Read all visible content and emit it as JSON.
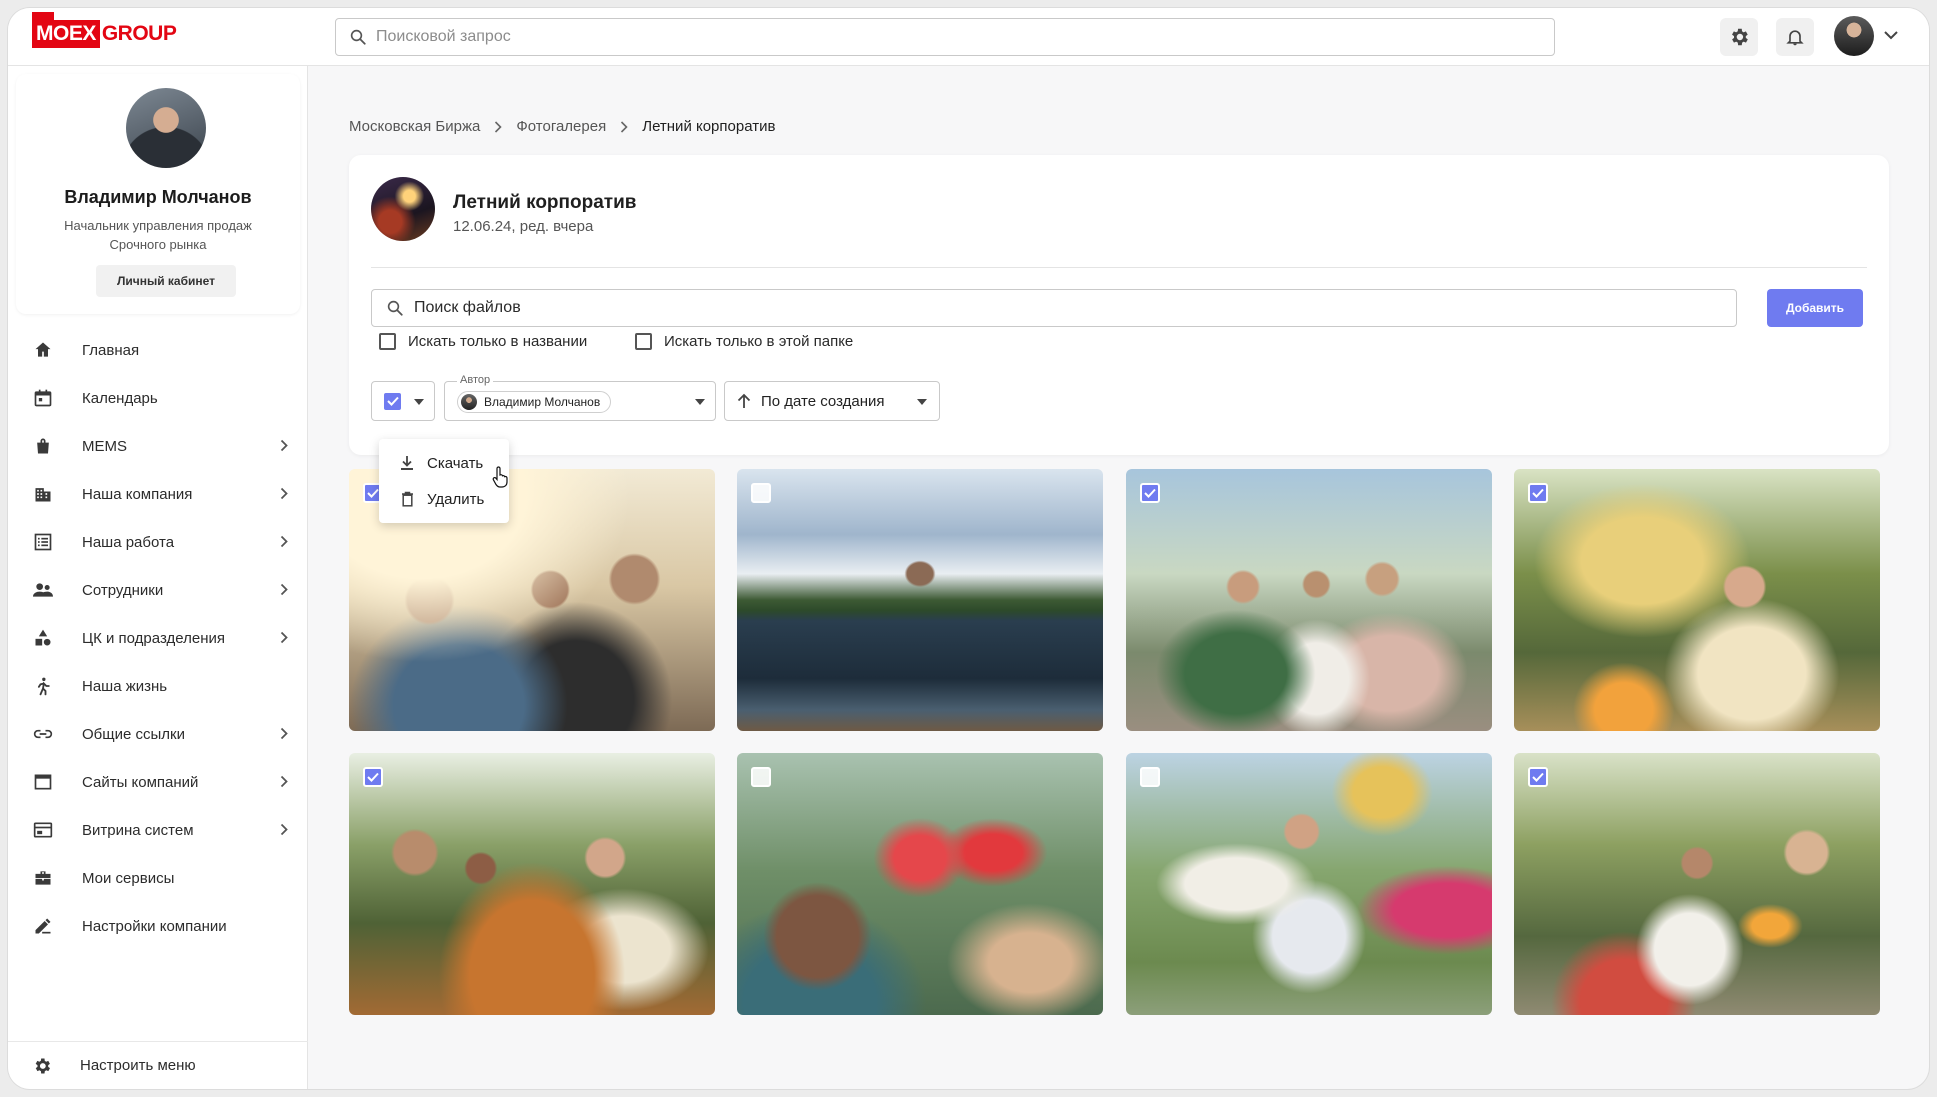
{
  "header": {
    "logo_moex": "MOEX",
    "logo_group": "GROUP",
    "search_placeholder": "Поисковой запрос",
    "icons": [
      "gear-icon",
      "bell-icon",
      "avatar",
      "chevron-down-icon"
    ]
  },
  "profile": {
    "name": "Владимир Молчанов",
    "role": "Начальник управления продаж Срочного рынка",
    "cabinet_label": "Личный кабинет"
  },
  "sidebar": {
    "items": [
      {
        "label": "Главная",
        "icon": "home-icon",
        "has_submenu": false
      },
      {
        "label": "Календарь",
        "icon": "calendar-icon",
        "has_submenu": false
      },
      {
        "label": "MEMS",
        "icon": "bag-icon",
        "has_submenu": true
      },
      {
        "label": "Наша компания",
        "icon": "building-icon",
        "has_submenu": true
      },
      {
        "label": "Наша работа",
        "icon": "list-icon",
        "has_submenu": true
      },
      {
        "label": "Сотрудники",
        "icon": "people-icon",
        "has_submenu": true
      },
      {
        "label": "ЦК и подразделения",
        "icon": "shapes-icon",
        "has_submenu": true
      },
      {
        "label": "Наша жизнь",
        "icon": "runner-icon",
        "has_submenu": false
      },
      {
        "label": "Общие ссылки",
        "icon": "link-icon",
        "has_submenu": true
      },
      {
        "label": "Сайты компаний",
        "icon": "window-icon",
        "has_submenu": true
      },
      {
        "label": "Витрина систем",
        "icon": "display-icon",
        "has_submenu": true
      },
      {
        "label": "Мои сервисы",
        "icon": "toolbox-icon",
        "has_submenu": false
      },
      {
        "label": "Настройки компании",
        "icon": "edit-icon",
        "has_submenu": false
      }
    ],
    "bottom_label": "Настроить меню"
  },
  "breadcrumb": {
    "items": [
      "Московская Биржа",
      "Фотогалерея",
      "Летний корпоратив"
    ]
  },
  "album": {
    "title": "Летний корпоратив",
    "meta": "12.06.24, ред. вчера"
  },
  "files": {
    "search_placeholder": "Поиск файлов",
    "add_label": "Добавить",
    "only_name_label": "Искать только в названии",
    "only_folder_label": "Искать только в этой папке"
  },
  "filters": {
    "select_all_checked": true,
    "author_label": "Автор",
    "author_value": "Владимир Молчанов",
    "sort_label": "По дате создания"
  },
  "bulk_menu": {
    "download_label": "Скачать",
    "delete_label": "Удалить"
  },
  "accent_color": "#6f7bf0",
  "brand_color": "#e30613",
  "photos": [
    {
      "checked": true
    },
    {
      "checked": false
    },
    {
      "checked": true
    },
    {
      "checked": true
    },
    {
      "checked": true
    },
    {
      "checked": false
    },
    {
      "checked": false
    },
    {
      "checked": true
    }
  ]
}
